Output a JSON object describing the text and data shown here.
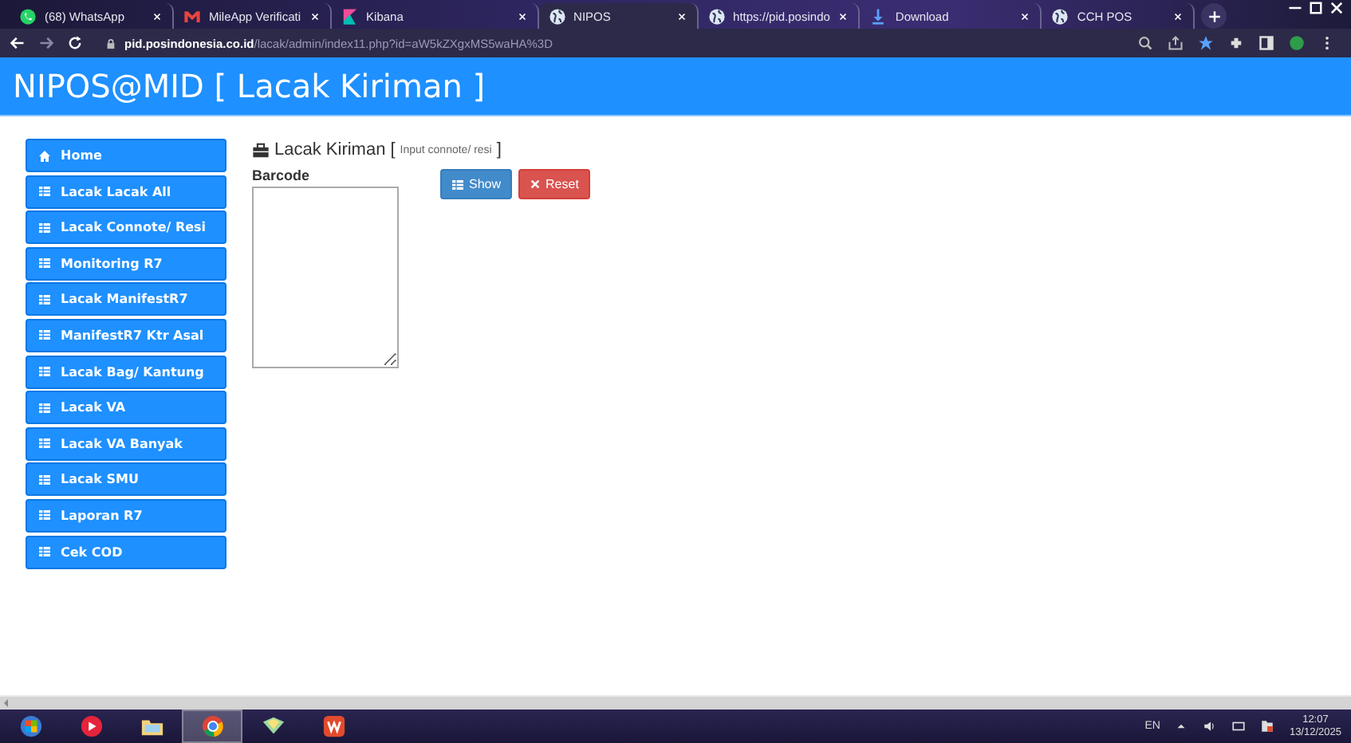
{
  "browser": {
    "tabs": [
      {
        "title": "(68) WhatsApp",
        "kind": "whatsapp",
        "selected": false
      },
      {
        "title": "MileApp Verificati",
        "kind": "mail",
        "selected": false
      },
      {
        "title": "Kibana",
        "kind": "kibana",
        "selected": false
      },
      {
        "title": "NIPOS",
        "kind": "globe",
        "selected": true
      },
      {
        "title": "https://pid.posindo",
        "kind": "globe",
        "selected": false
      },
      {
        "title": "Download",
        "kind": "download",
        "selected": false
      },
      {
        "title": "CCH POS",
        "kind": "globe",
        "selected": false
      }
    ],
    "address": {
      "host": "pid.posindonesia.co.id",
      "path": "/lacak/admin/index11.php?id=aW5kZXgxMS5waHA%3D"
    }
  },
  "header": {
    "title": "NIPOS@MID [ Lacak Kiriman ]"
  },
  "sidebar": {
    "items": [
      {
        "label": "Home",
        "kind": "home"
      },
      {
        "label": "Lacak Lacak All",
        "kind": "table"
      },
      {
        "label": "Lacak Connote/ Resi",
        "kind": "table"
      },
      {
        "label": "Monitoring R7",
        "kind": "table"
      },
      {
        "label": "Lacak ManifestR7",
        "kind": "table"
      },
      {
        "label": "ManifestR7 Ktr Asal",
        "kind": "table"
      },
      {
        "label": "Lacak Bag/ Kantung",
        "kind": "table"
      },
      {
        "label": "Lacak VA",
        "kind": "table"
      },
      {
        "label": "Lacak VA Banyak",
        "kind": "table"
      },
      {
        "label": "Lacak SMU",
        "kind": "table"
      },
      {
        "label": "Laporan R7",
        "kind": "table"
      },
      {
        "label": "Cek COD",
        "kind": "table"
      }
    ]
  },
  "main": {
    "heading": "Lacak Kiriman",
    "bracket_open": "[",
    "hint": "Input connote/ resi",
    "bracket_close": "]",
    "field_label": "Barcode",
    "buttons": [
      {
        "label": "Show",
        "kind": "primary"
      },
      {
        "label": "Reset",
        "kind": "danger"
      }
    ]
  },
  "taskbar": {
    "apps": [
      {
        "kind": "start",
        "selected": false
      },
      {
        "kind": "music",
        "selected": false
      },
      {
        "kind": "folder",
        "selected": false
      },
      {
        "kind": "chrome",
        "selected": true
      },
      {
        "kind": "notes",
        "selected": false
      },
      {
        "kind": "office",
        "selected": false
      }
    ],
    "language": "EN",
    "time": "12:07",
    "date": "13/12/2025"
  }
}
